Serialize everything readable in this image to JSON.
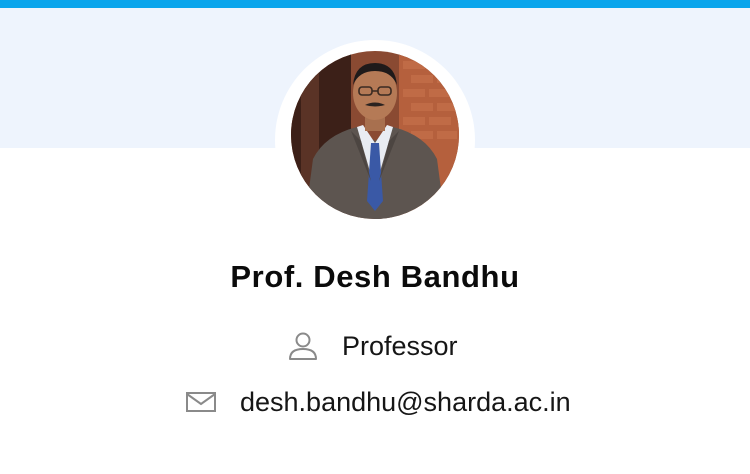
{
  "profile": {
    "name": "Prof. Desh Bandhu",
    "designation": "Professor",
    "email": "desh.bandhu@sharda.ac.in"
  },
  "icons": {
    "designation": "user-icon",
    "email": "mail-icon"
  },
  "colors": {
    "accent_bar": "#0aa5ec",
    "header_band": "#eef4fd",
    "text": "#161616",
    "icon": "#8a8a8a"
  }
}
